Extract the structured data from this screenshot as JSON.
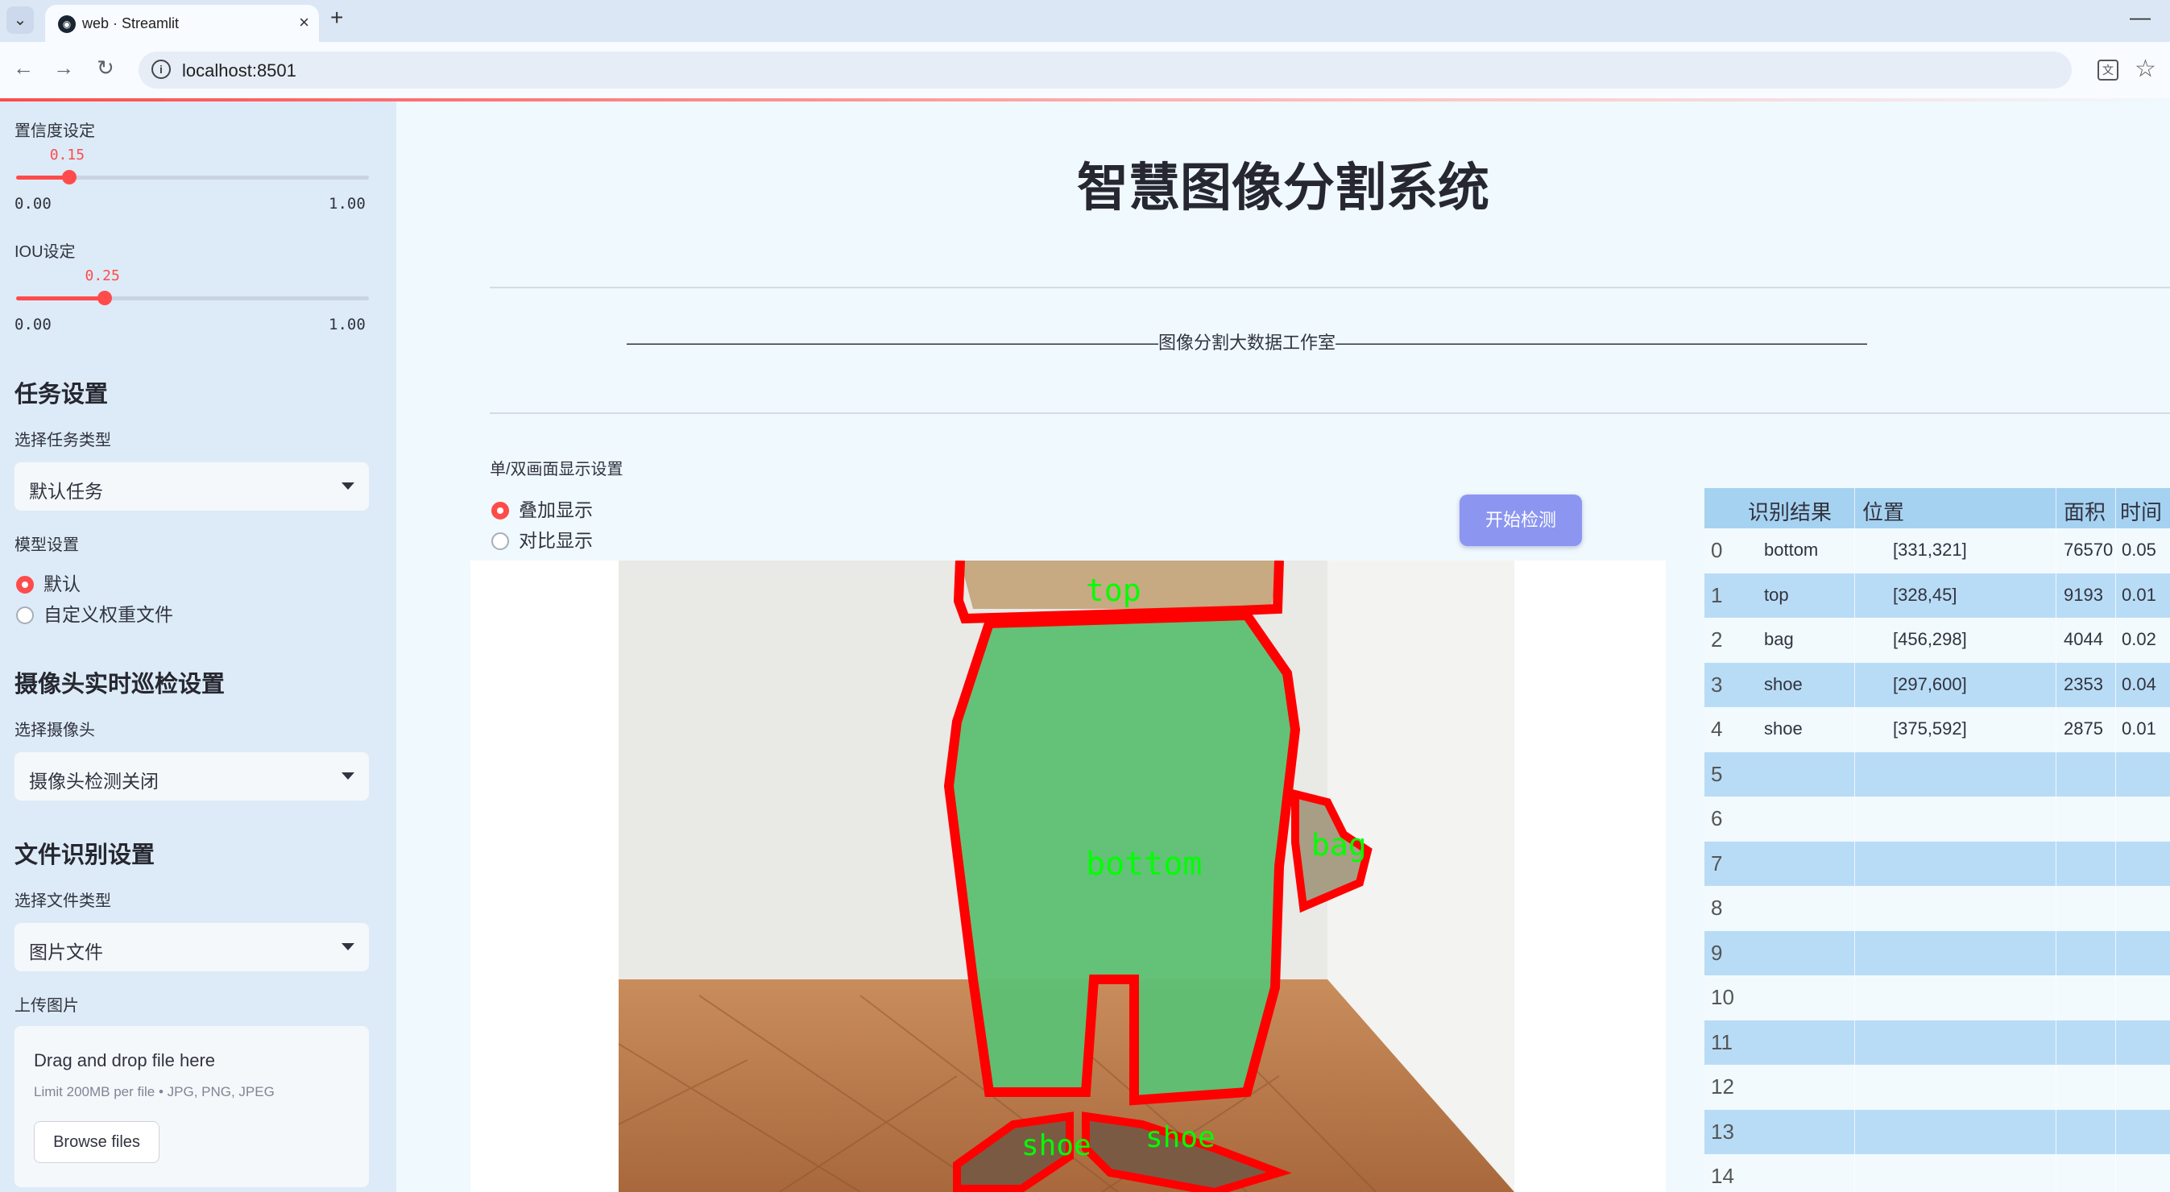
{
  "browser": {
    "tab_title": "web · Streamlit",
    "url": "localhost:8501"
  },
  "sidebar": {
    "confidence": {
      "label": "置信度设定",
      "value": "0.15",
      "value_num": 0.15,
      "min": "0.00",
      "max": "1.00"
    },
    "iou": {
      "label": "IOU设定",
      "value": "0.25",
      "value_num": 0.25,
      "min": "0.00",
      "max": "1.00"
    },
    "task_heading": "任务设置",
    "task_type_label": "选择任务类型",
    "task_type_value": "默认任务",
    "model_label": "模型设置",
    "model_options": [
      "默认",
      "自定义权重文件"
    ],
    "camera_heading": "摄像头实时巡检设置",
    "camera_label": "选择摄像头",
    "camera_value": "摄像头检测关闭",
    "file_heading": "文件识别设置",
    "file_type_label": "选择文件类型",
    "file_type_value": "图片文件",
    "upload_label": "上传图片",
    "upload_title": "Drag and drop file here",
    "upload_limit": "Limit 200MB per file • JPG, PNG, JPEG",
    "browse_label": "Browse files"
  },
  "main": {
    "title": "智慧图像分割系统",
    "banner": "——————————————————————————————图像分割大数据工作室——————————————————————————————",
    "display_label": "单/双画面显示设置",
    "display_options": [
      "叠加显示",
      "对比显示"
    ],
    "start_button": "开始检测",
    "detections": [
      "top",
      "bottom",
      "bag",
      "shoe",
      "shoe"
    ]
  },
  "table": {
    "headers": [
      "识别结果",
      "位置",
      "面积",
      "时间"
    ],
    "rows": [
      {
        "idx": "0",
        "label": "bottom",
        "pos": "[331,321]",
        "area": "76570",
        "time": "0.05"
      },
      {
        "idx": "1",
        "label": "top",
        "pos": "[328,45]",
        "area": "9193",
        "time": "0.01"
      },
      {
        "idx": "2",
        "label": "bag",
        "pos": "[456,298]",
        "area": "4044",
        "time": "0.02"
      },
      {
        "idx": "3",
        "label": "shoe",
        "pos": "[297,600]",
        "area": "2353",
        "time": "0.04"
      },
      {
        "idx": "4",
        "label": "shoe",
        "pos": "[375,592]",
        "area": "2875",
        "time": "0.01"
      },
      {
        "idx": "5",
        "label": "",
        "pos": "",
        "area": "",
        "time": ""
      },
      {
        "idx": "6",
        "label": "",
        "pos": "",
        "area": "",
        "time": ""
      },
      {
        "idx": "7",
        "label": "",
        "pos": "",
        "area": "",
        "time": ""
      },
      {
        "idx": "8",
        "label": "",
        "pos": "",
        "area": "",
        "time": ""
      },
      {
        "idx": "9",
        "label": "",
        "pos": "",
        "area": "",
        "time": ""
      },
      {
        "idx": "10",
        "label": "",
        "pos": "",
        "area": "",
        "time": ""
      },
      {
        "idx": "11",
        "label": "",
        "pos": "",
        "area": "",
        "time": ""
      },
      {
        "idx": "12",
        "label": "",
        "pos": "",
        "area": "",
        "time": ""
      },
      {
        "idx": "13",
        "label": "",
        "pos": "",
        "area": "",
        "time": ""
      },
      {
        "idx": "14",
        "label": "",
        "pos": "",
        "area": "",
        "time": ""
      }
    ]
  },
  "colors": {
    "accent": "#ff4b4b",
    "button": "#8c96f0",
    "mask": "#5dc074",
    "outline": "#ff0000",
    "label_text": "#00ff00"
  },
  "icons": [
    "tab-list-icon",
    "streamlit-icon",
    "close-icon",
    "plus-icon",
    "minimize-icon",
    "back-icon",
    "forward-icon",
    "reload-icon",
    "info-icon",
    "translate-icon",
    "star-icon",
    "chevron-down-icon"
  ]
}
